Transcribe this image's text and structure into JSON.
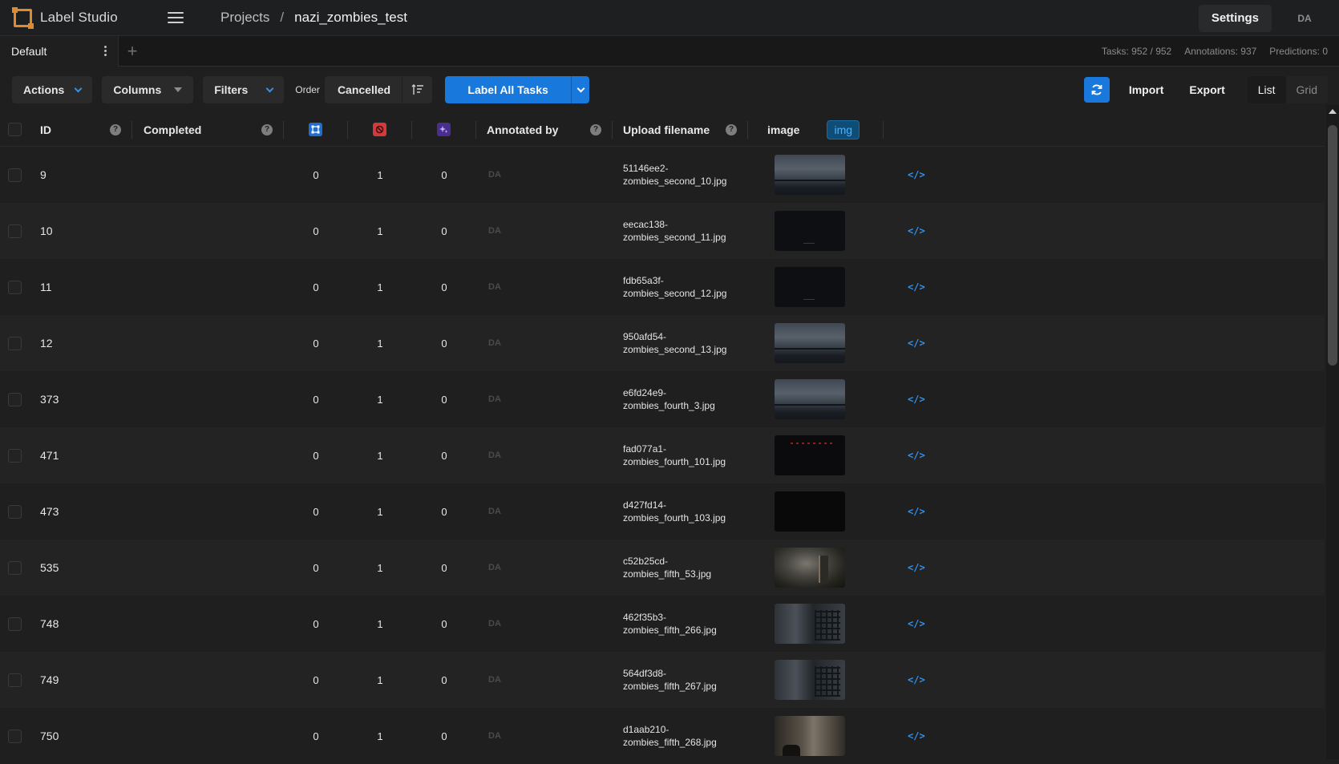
{
  "app": {
    "name": "Label Studio"
  },
  "breadcrumb": {
    "projects": "Projects",
    "separator": "/",
    "current": "nazi_zombies_test"
  },
  "header": {
    "settings": "Settings",
    "avatar": "DA"
  },
  "tabs": {
    "items": [
      {
        "label": "Default"
      }
    ],
    "add": "+"
  },
  "stats": {
    "tasks": "Tasks: 952 / 952",
    "annotations": "Annotations: 937",
    "predictions": "Predictions: 0"
  },
  "toolbar": {
    "actions": "Actions",
    "columns": "Columns",
    "filters": "Filters",
    "order_label": "Order",
    "order_value": "Cancelled",
    "label_all": "Label All Tasks",
    "import": "Import",
    "export": "Export",
    "view_list": "List",
    "view_grid": "Grid"
  },
  "table": {
    "headers": {
      "id": "ID",
      "completed": "Completed",
      "annotated_by": "Annotated by",
      "upload_filename": "Upload filename",
      "image": "image",
      "image_tag": "img"
    },
    "rows": [
      {
        "id": "9",
        "total": "0",
        "cancelled": "1",
        "predictions": "0",
        "annotator": "DA",
        "file1": "51146ee2-",
        "file2": "zombies_second_10.jpg",
        "thumb": "storm"
      },
      {
        "id": "10",
        "total": "0",
        "cancelled": "1",
        "predictions": "0",
        "annotator": "DA",
        "file1": "eecac138-",
        "file2": "zombies_second_11.jpg",
        "thumb": "dark"
      },
      {
        "id": "11",
        "total": "0",
        "cancelled": "1",
        "predictions": "0",
        "annotator": "DA",
        "file1": "fdb65a3f-",
        "file2": "zombies_second_12.jpg",
        "thumb": "dark"
      },
      {
        "id": "12",
        "total": "0",
        "cancelled": "1",
        "predictions": "0",
        "annotator": "DA",
        "file1": "950afd54-",
        "file2": "zombies_second_13.jpg",
        "thumb": "storm"
      },
      {
        "id": "373",
        "total": "0",
        "cancelled": "1",
        "predictions": "0",
        "annotator": "DA",
        "file1": "e6fd24e9-",
        "file2": "zombies_fourth_3.jpg",
        "thumb": "storm"
      },
      {
        "id": "471",
        "total": "0",
        "cancelled": "1",
        "predictions": "0",
        "annotator": "DA",
        "file1": "fad077a1-",
        "file2": "zombies_fourth_101.jpg",
        "thumb": "dark2"
      },
      {
        "id": "473",
        "total": "0",
        "cancelled": "1",
        "predictions": "0",
        "annotator": "DA",
        "file1": "d427fd14-",
        "file2": "zombies_fourth_103.jpg",
        "thumb": "black"
      },
      {
        "id": "535",
        "total": "0",
        "cancelled": "1",
        "predictions": "0",
        "annotator": "DA",
        "file1": "c52b25cd-",
        "file2": "zombies_fifth_53.jpg",
        "thumb": "room"
      },
      {
        "id": "748",
        "total": "0",
        "cancelled": "1",
        "predictions": "0",
        "annotator": "DA",
        "file1": "462f35b3-",
        "file2": "zombies_fifth_266.jpg",
        "thumb": "grate"
      },
      {
        "id": "749",
        "total": "0",
        "cancelled": "1",
        "predictions": "0",
        "annotator": "DA",
        "file1": "564df3d8-",
        "file2": "zombies_fifth_267.jpg",
        "thumb": "grate"
      },
      {
        "id": "750",
        "total": "0",
        "cancelled": "1",
        "predictions": "0",
        "annotator": "DA",
        "file1": "d1aab210-",
        "file2": "zombies_fifth_268.jpg",
        "thumb": "hall"
      }
    ],
    "code_glyph": "</>"
  },
  "colors": {
    "accent": "#1878dc",
    "logo": "#e08a2c",
    "cancel_icon": "#d13b3b",
    "prediction_icon": "#6b3fd6",
    "total_icon": "#1f6fd1"
  }
}
